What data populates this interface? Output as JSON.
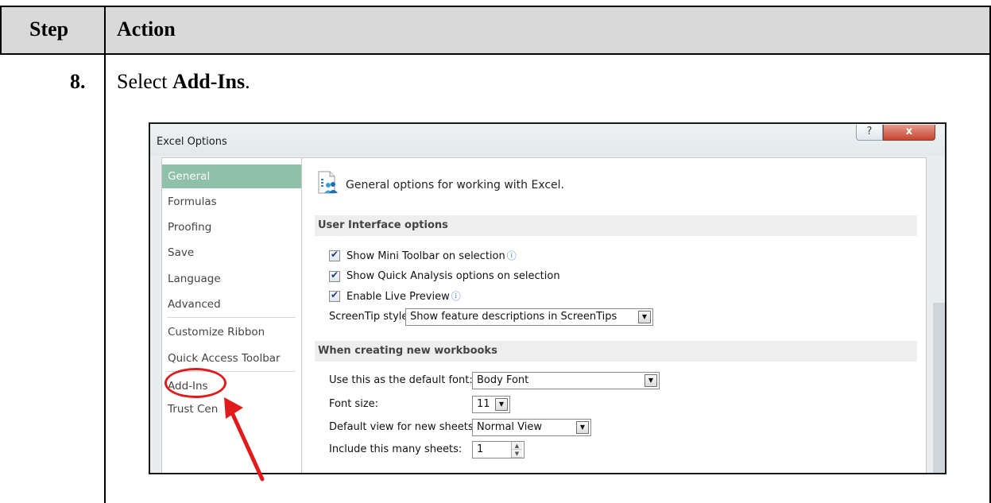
{
  "table": {
    "header_step": "Step",
    "header_action": "Action",
    "step_number": "8.",
    "instruction_prefix": "Select ",
    "instruction_bold": "Add-Ins",
    "instruction_suffix": "."
  },
  "dialog": {
    "title": "Excel Options",
    "help_button": "?",
    "close_button": "x",
    "nav_items": [
      {
        "label": "General",
        "selected": true
      },
      {
        "label": "Formulas"
      },
      {
        "label": "Proofing"
      },
      {
        "label": "Save"
      },
      {
        "label": "Language"
      },
      {
        "label": "Advanced"
      },
      {
        "label": "Customize Ribbon"
      },
      {
        "label": "Quick Access Toolbar"
      },
      {
        "label": "Add-Ins"
      },
      {
        "label": "Trust Cen"
      }
    ],
    "general_heading": "General options for working with Excel.",
    "section_ui": "User Interface options",
    "options_ui": [
      {
        "label": "Show Mini Toolbar on selection",
        "checked": true,
        "info": true
      },
      {
        "label": "Show Quick Analysis options on selection",
        "checked": true
      },
      {
        "label": "Enable Live Preview",
        "checked": true,
        "info": true
      }
    ],
    "screentip_label": "ScreenTip style:",
    "screentip_value": "Show feature descriptions in ScreenTips",
    "section_workbooks": "When creating new workbooks",
    "default_font_label": "Use this as the default font:",
    "default_font_value": "Body Font",
    "font_size_label": "Font size:",
    "font_size_value": "11",
    "default_view_label": "Default view for new sheets:",
    "default_view_value": "Normal View",
    "sheets_label": "Include this many sheets:",
    "sheets_value": "1"
  },
  "colors": {
    "selected_nav": "#8fc0a9",
    "annotation": "#e11b1b",
    "header_band": "#d9d9d9"
  }
}
